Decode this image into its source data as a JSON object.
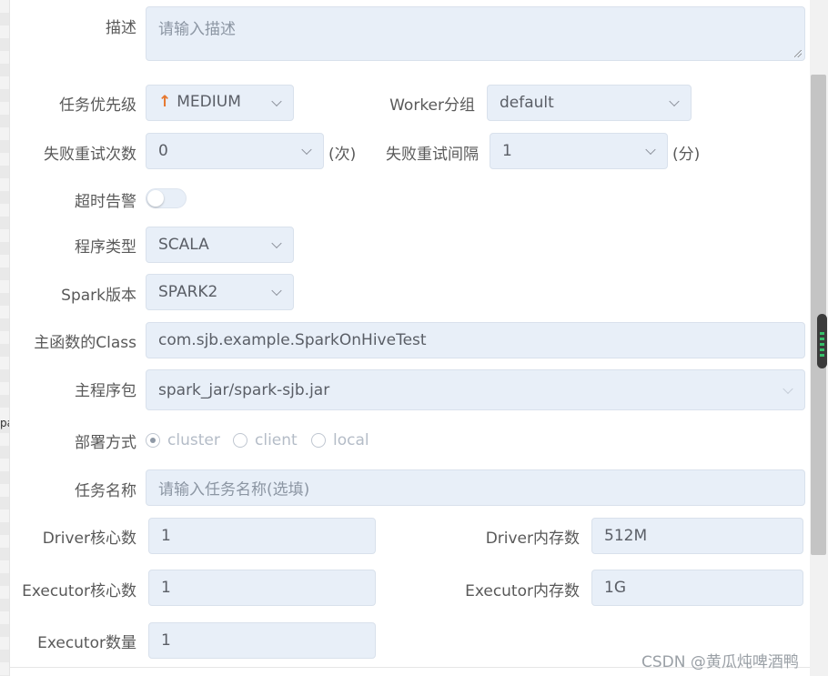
{
  "side_text": "pa",
  "form": {
    "description": {
      "label": "描述",
      "placeholder": "请输入描述"
    },
    "priority": {
      "label": "任务优先级",
      "value": "MEDIUM",
      "icon": "arrow-up-icon",
      "icon_glyph": "↑",
      "icon_color": "#e6772e"
    },
    "worker_group": {
      "label": "Worker分组",
      "value": "default"
    },
    "retry_times": {
      "label": "失败重试次数",
      "value": "0",
      "unit": "(次)"
    },
    "retry_interval": {
      "label": "失败重试间隔",
      "value": "1",
      "unit": "(分)"
    },
    "timeout_alarm": {
      "label": "超时告警",
      "enabled": false
    },
    "program_type": {
      "label": "程序类型",
      "value": "SCALA"
    },
    "spark_version": {
      "label": "Spark版本",
      "value": "SPARK2"
    },
    "main_class": {
      "label": "主函数的Class",
      "value": "com.sjb.example.SparkOnHiveTest"
    },
    "main_package": {
      "label": "主程序包",
      "value": "spark_jar/spark-sjb.jar"
    },
    "deploy_mode": {
      "label": "部署方式",
      "options": [
        "cluster",
        "client",
        "local"
      ],
      "selected": "cluster"
    },
    "task_name": {
      "label": "任务名称",
      "placeholder": "请输入任务名称(选填)"
    },
    "driver_cores": {
      "label": "Driver核心数",
      "value": "1"
    },
    "driver_memory": {
      "label": "Driver内存数",
      "value": "512M"
    },
    "executor_cores": {
      "label": "Executor核心数",
      "value": "1"
    },
    "executor_memory": {
      "label": "Executor内存数",
      "value": "1G"
    },
    "executor_count": {
      "label": "Executor数量",
      "value": "1"
    }
  },
  "watermark": "CSDN @黄瓜炖啤酒鸭",
  "colors": {
    "input_bg": "#e8eff8",
    "label": "#595959",
    "accent_arrow": "#e6772e"
  }
}
